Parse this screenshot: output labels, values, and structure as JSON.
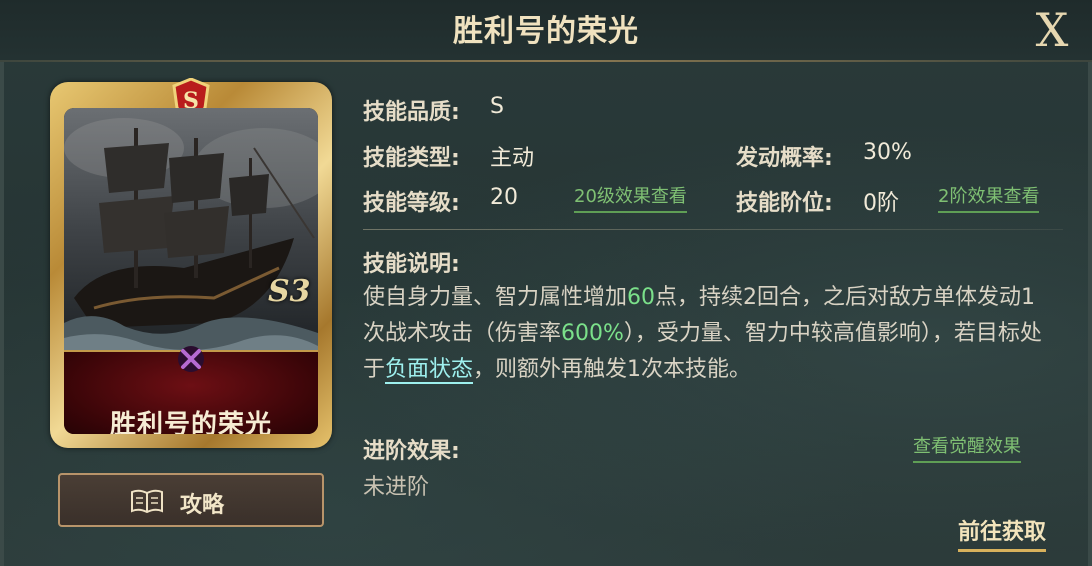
{
  "window": {
    "title": "胜利号的荣光",
    "close_label": "X"
  },
  "card": {
    "name": "胜利号的荣光",
    "grade_badge": "S",
    "season_mark": "S3",
    "emblem_icon": "crossed-swords-icon",
    "art": "warship-illustration"
  },
  "guide_button": {
    "label": "攻略",
    "icon": "open-book-icon"
  },
  "info": {
    "quality_label": "技能品质:",
    "quality_value": "S",
    "type_label": "技能类型:",
    "type_value": "主动",
    "chance_label": "发动概率:",
    "chance_value": "30%",
    "level_label": "技能等级:",
    "level_value": "20",
    "level_link": "20级效果查看",
    "rank_label": "技能阶位:",
    "rank_value": "0阶",
    "rank_link": "2阶效果查看"
  },
  "description": {
    "label": "技能说明:",
    "part1": "使自身力量、智力属性增加",
    "num1": "60",
    "part2": "点，持续2回合，之后对敌方单体发动1次战术攻击（伤害率",
    "num2": "600%",
    "part3": "），受力量、智力中较高值影响），若目标处于",
    "status_link": "负面状态",
    "part4": "，则额外再触发1次本技能。"
  },
  "advance": {
    "label": "进阶效果:",
    "value": "未进阶",
    "awaken_link": "查看觉醒效果"
  },
  "obtain_link": "前往获取",
  "colors": {
    "accent_gold": "#d7b15c",
    "link_green": "#7fc073",
    "highlight_cyan": "#9ef0ee",
    "number_green": "#7be08a"
  }
}
